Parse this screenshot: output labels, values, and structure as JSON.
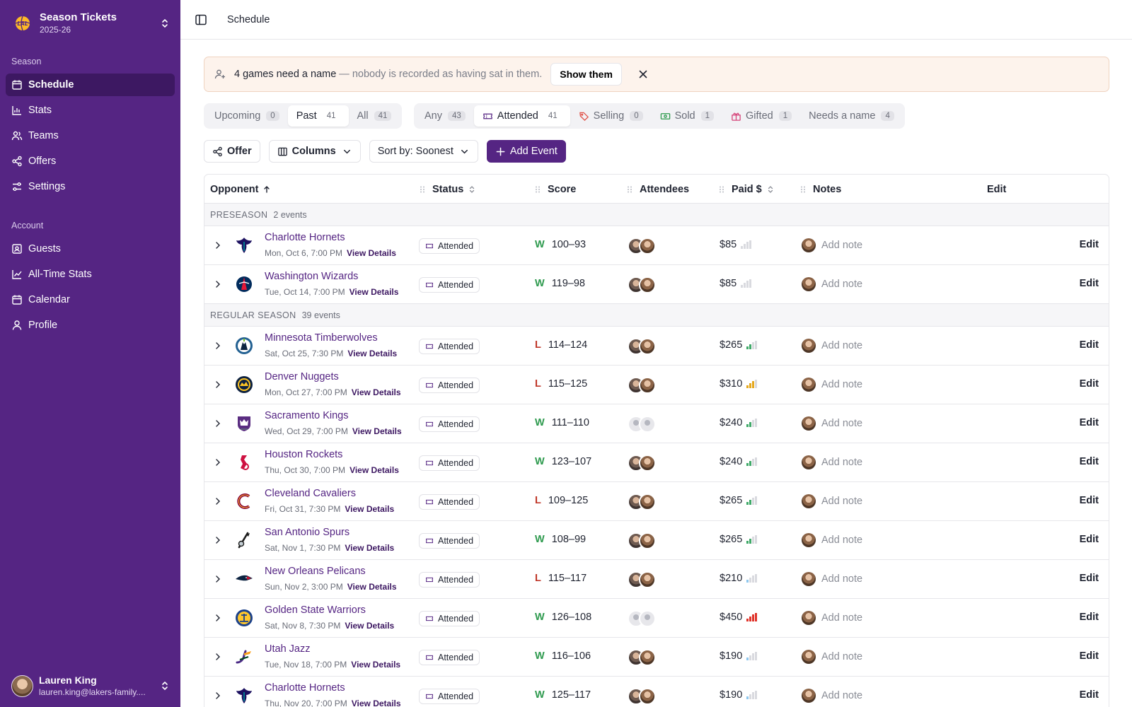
{
  "brand": {
    "title": "Season Tickets",
    "subtitle": "2025-26"
  },
  "nav": {
    "season_label": "Season",
    "season_items": [
      {
        "label": "Schedule",
        "icon": "calendar-icon",
        "active": true
      },
      {
        "label": "Stats",
        "icon": "bar-chart-icon"
      },
      {
        "label": "Teams",
        "icon": "users-icon"
      },
      {
        "label": "Offers",
        "icon": "share-icon"
      },
      {
        "label": "Settings",
        "icon": "sliders-icon"
      }
    ],
    "account_label": "Account",
    "account_items": [
      {
        "label": "Guests",
        "icon": "contact-card-icon"
      },
      {
        "label": "All-Time Stats",
        "icon": "line-chart-icon"
      },
      {
        "label": "Calendar",
        "icon": "calendar-icon"
      },
      {
        "label": "Profile",
        "icon": "user-icon"
      }
    ]
  },
  "user": {
    "name": "Lauren King",
    "email": "lauren.king@lakers-family...."
  },
  "topbar": {
    "breadcrumb": "Schedule"
  },
  "alert": {
    "strong": "4 games need a name",
    "muted": "— nobody is recorded as having sat in them.",
    "button": "Show them"
  },
  "time_tabs": [
    {
      "label": "Upcoming",
      "count": "0"
    },
    {
      "label": "Past",
      "count": "41",
      "active": true
    },
    {
      "label": "All",
      "count": "41"
    }
  ],
  "status_tabs": [
    {
      "label": "Any",
      "count": "43"
    },
    {
      "label": "Attended",
      "count": "41",
      "active": true,
      "icon": "ticket-icon"
    },
    {
      "label": "Selling",
      "count": "0",
      "icon": "tag-icon"
    },
    {
      "label": "Sold",
      "count": "1",
      "icon": "banknote-icon"
    },
    {
      "label": "Gifted",
      "count": "1",
      "icon": "gift-icon"
    },
    {
      "label": "Needs a name",
      "count": "4"
    }
  ],
  "toolbar": {
    "offer": "Offer",
    "columns": "Columns",
    "sort": "Sort by: Soonest",
    "add": "Add Event"
  },
  "columns": {
    "opponent": "Opponent",
    "status": "Status",
    "score": "Score",
    "attendees": "Attendees",
    "paid": "Paid $",
    "notes": "Notes",
    "edit": "Edit"
  },
  "colors": {
    "accent": "#552583",
    "accent_dark": "#3d1862",
    "win": "#2e9a4e",
    "loss": "#c0392b"
  },
  "row_labels": {
    "view_details": "View Details",
    "add_note": "Add note",
    "edit": "Edit"
  },
  "groups": [
    {
      "label": "PRESEASON",
      "count": "2 events",
      "rows": [
        {
          "team": "Charlotte Hornets",
          "date": "Mon, Oct 6, 7:00 PM",
          "status": "Attended",
          "result": "W",
          "score": "100–93",
          "attendees": "photo",
          "paid": "$85",
          "price_level": 0,
          "logo": "hornets"
        },
        {
          "team": "Washington Wizards",
          "date": "Tue, Oct 14, 7:00 PM",
          "status": "Attended",
          "result": "W",
          "score": "119–98",
          "attendees": "photo",
          "paid": "$85",
          "price_level": 0,
          "logo": "wizards"
        }
      ]
    },
    {
      "label": "REGULAR SEASON",
      "count": "39 events",
      "rows": [
        {
          "team": "Minnesota Timberwolves",
          "date": "Sat, Oct 25, 7:30 PM",
          "status": "Attended",
          "result": "L",
          "score": "114–124",
          "attendees": "photo",
          "paid": "$265",
          "price_level": 2,
          "logo": "wolves"
        },
        {
          "team": "Denver Nuggets",
          "date": "Mon, Oct 27, 7:00 PM",
          "status": "Attended",
          "result": "L",
          "score": "115–125",
          "attendees": "photo",
          "paid": "$310",
          "price_level": 3,
          "logo": "nuggets"
        },
        {
          "team": "Sacramento Kings",
          "date": "Wed, Oct 29, 7:00 PM",
          "status": "Attended",
          "result": "W",
          "score": "111–110",
          "attendees": "placeholder",
          "paid": "$240",
          "price_level": 2,
          "logo": "kings"
        },
        {
          "team": "Houston Rockets",
          "date": "Thu, Oct 30, 7:00 PM",
          "status": "Attended",
          "result": "W",
          "score": "123–107",
          "attendees": "photo",
          "paid": "$240",
          "price_level": 2,
          "logo": "rockets"
        },
        {
          "team": "Cleveland Cavaliers",
          "date": "Fri, Oct 31, 7:30 PM",
          "status": "Attended",
          "result": "L",
          "score": "109–125",
          "attendees": "photo",
          "paid": "$265",
          "price_level": 2,
          "logo": "cavs"
        },
        {
          "team": "San Antonio Spurs",
          "date": "Sat, Nov 1, 7:30 PM",
          "status": "Attended",
          "result": "W",
          "score": "108–99",
          "attendees": "photo",
          "paid": "$265",
          "price_level": 2,
          "logo": "spurs"
        },
        {
          "team": "New Orleans Pelicans",
          "date": "Sun, Nov 2, 3:00 PM",
          "status": "Attended",
          "result": "L",
          "score": "115–117",
          "attendees": "photo",
          "paid": "$210",
          "price_level": 1,
          "logo": "pelicans"
        },
        {
          "team": "Golden State Warriors",
          "date": "Sat, Nov 8, 7:30 PM",
          "status": "Attended",
          "result": "W",
          "score": "126–108",
          "attendees": "placeholder",
          "paid": "$450",
          "price_level": 4,
          "logo": "warriors"
        },
        {
          "team": "Utah Jazz",
          "date": "Tue, Nov 18, 7:00 PM",
          "status": "Attended",
          "result": "W",
          "score": "116–106",
          "attendees": "photo",
          "paid": "$190",
          "price_level": 1,
          "logo": "jazz"
        },
        {
          "team": "Charlotte Hornets",
          "date": "Thu, Nov 20, 7:00 PM",
          "status": "Attended",
          "result": "W",
          "score": "125–117",
          "attendees": "photo",
          "paid": "$190",
          "price_level": 1,
          "logo": "hornets"
        }
      ]
    }
  ]
}
